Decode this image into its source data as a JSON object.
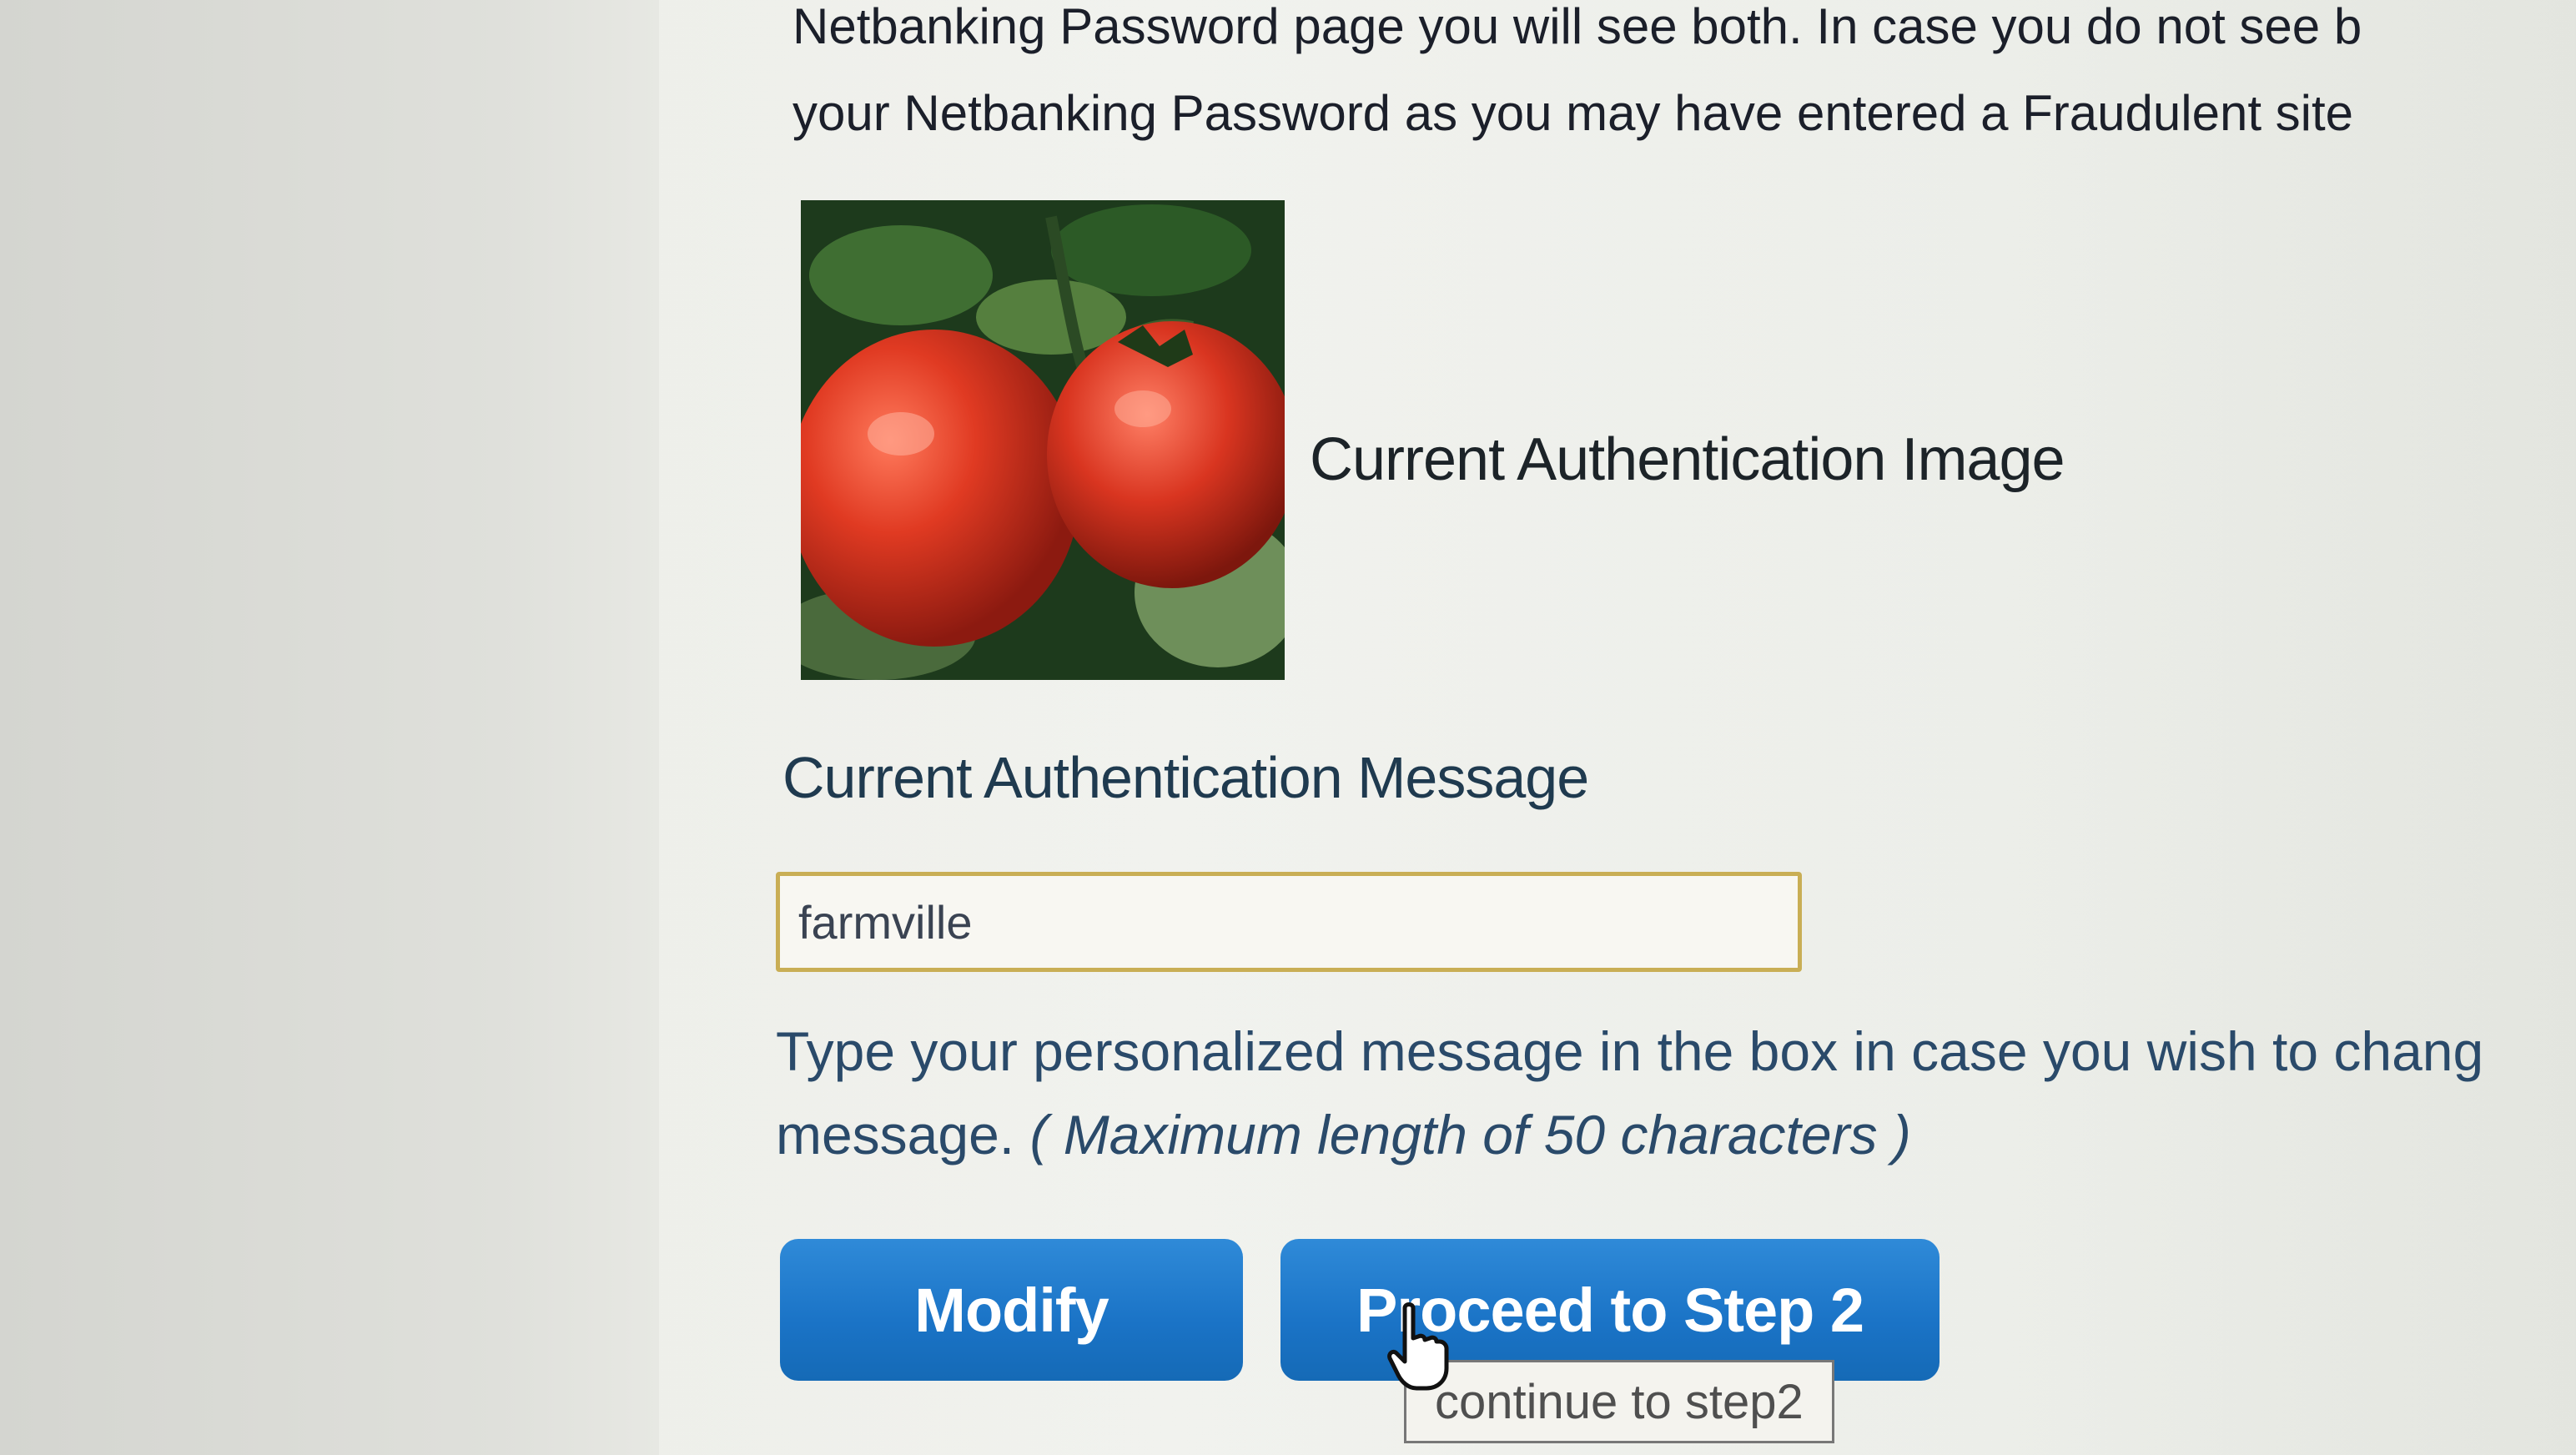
{
  "intro": {
    "line1": "Netbanking Password page you will see both. In case you do not see b",
    "line2": "your Netbanking Password as you may have entered a Fraudulent site"
  },
  "auth_image": {
    "label": "Current Authentication Image",
    "icon": "tomato-photo-icon"
  },
  "auth_message": {
    "label": "Current Authentication Message",
    "value": "farmville"
  },
  "hint": {
    "line1": "Type your personalized message in the box in case you wish to chang",
    "line2_prefix": "message.",
    "line2_italic": "( Maximum length of 50 characters )"
  },
  "buttons": {
    "modify": "Modify",
    "proceed": "Proceed to Step 2"
  },
  "tooltip": "continue to step2",
  "colors": {
    "button_blue": "#1a73c6",
    "input_border": "#c9ae55",
    "hint_text": "#2a4a6a"
  }
}
